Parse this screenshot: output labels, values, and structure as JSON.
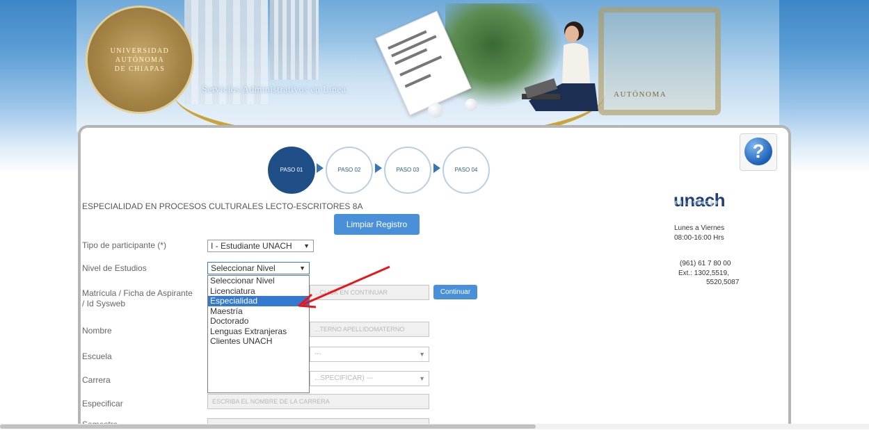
{
  "header": {
    "university_name": [
      "UNIVERSIDAD",
      "AUTÓNOMA",
      "DE CHIAPAS"
    ],
    "slogan": "Servicios Administrativos en Línea",
    "crest_text": "AUTÓNOMA"
  },
  "steps": [
    {
      "label": "PASO 01",
      "active": true
    },
    {
      "label": "PASO 02",
      "active": false
    },
    {
      "label": "PASO 03",
      "active": false
    },
    {
      "label": "PASO 04",
      "active": false
    }
  ],
  "program_title": "ESPECIALIDAD EN PROCESOS CULTURALES LECTO-ESCRITORES 8A",
  "buttons": {
    "clear": "Limpiar Registro",
    "continue": "Continuar"
  },
  "form": {
    "tipo_label": "Tipo de participante (*)",
    "tipo_value": "I - Estudiante UNACH",
    "nivel_label": "Nivel de Estudios",
    "nivel_value": "Seleccionar Nivel",
    "matricula_label": "Matrícula / Ficha de Aspirante / Id Sysweb",
    "matricula_placeholder": "...CLICK EN CONTINUAR",
    "nombre_label": "Nombre",
    "nombre_placeholder": "...TERNO APELLIDOMATERNO",
    "escuela_label": "Escuela",
    "escuela_value": "---",
    "carrera_label": "Carrera",
    "carrera_value": "...SPECIFICAR) ---",
    "especificar_label": "Especificar",
    "especificar_placeholder": "ESCRIBA EL NOMBRE DE LA CARRERA",
    "semestre_label": "Semestre"
  },
  "dropdown": {
    "options": [
      "Seleccionar Nivel",
      "Licenciatura",
      "Especialidad",
      "Maestría",
      "Doctorado",
      "Lenguas Extranjeras",
      "Clientes UNACH"
    ],
    "selected_index": 2
  },
  "sidebar": {
    "logo": "unach",
    "hours_days": "Lunes a Viernes",
    "hours_time": "08:00-16:00 Hrs",
    "phone": "(961) 61 7 80 00",
    "ext_line1": "Ext.: 1302,5519,",
    "ext_line2": "5520,5087"
  },
  "colors": {
    "accent_blue": "#4a90d9",
    "step_active": "#1f4f86",
    "selected_option": "#3478cf",
    "annotation_red": "#e8151b"
  }
}
